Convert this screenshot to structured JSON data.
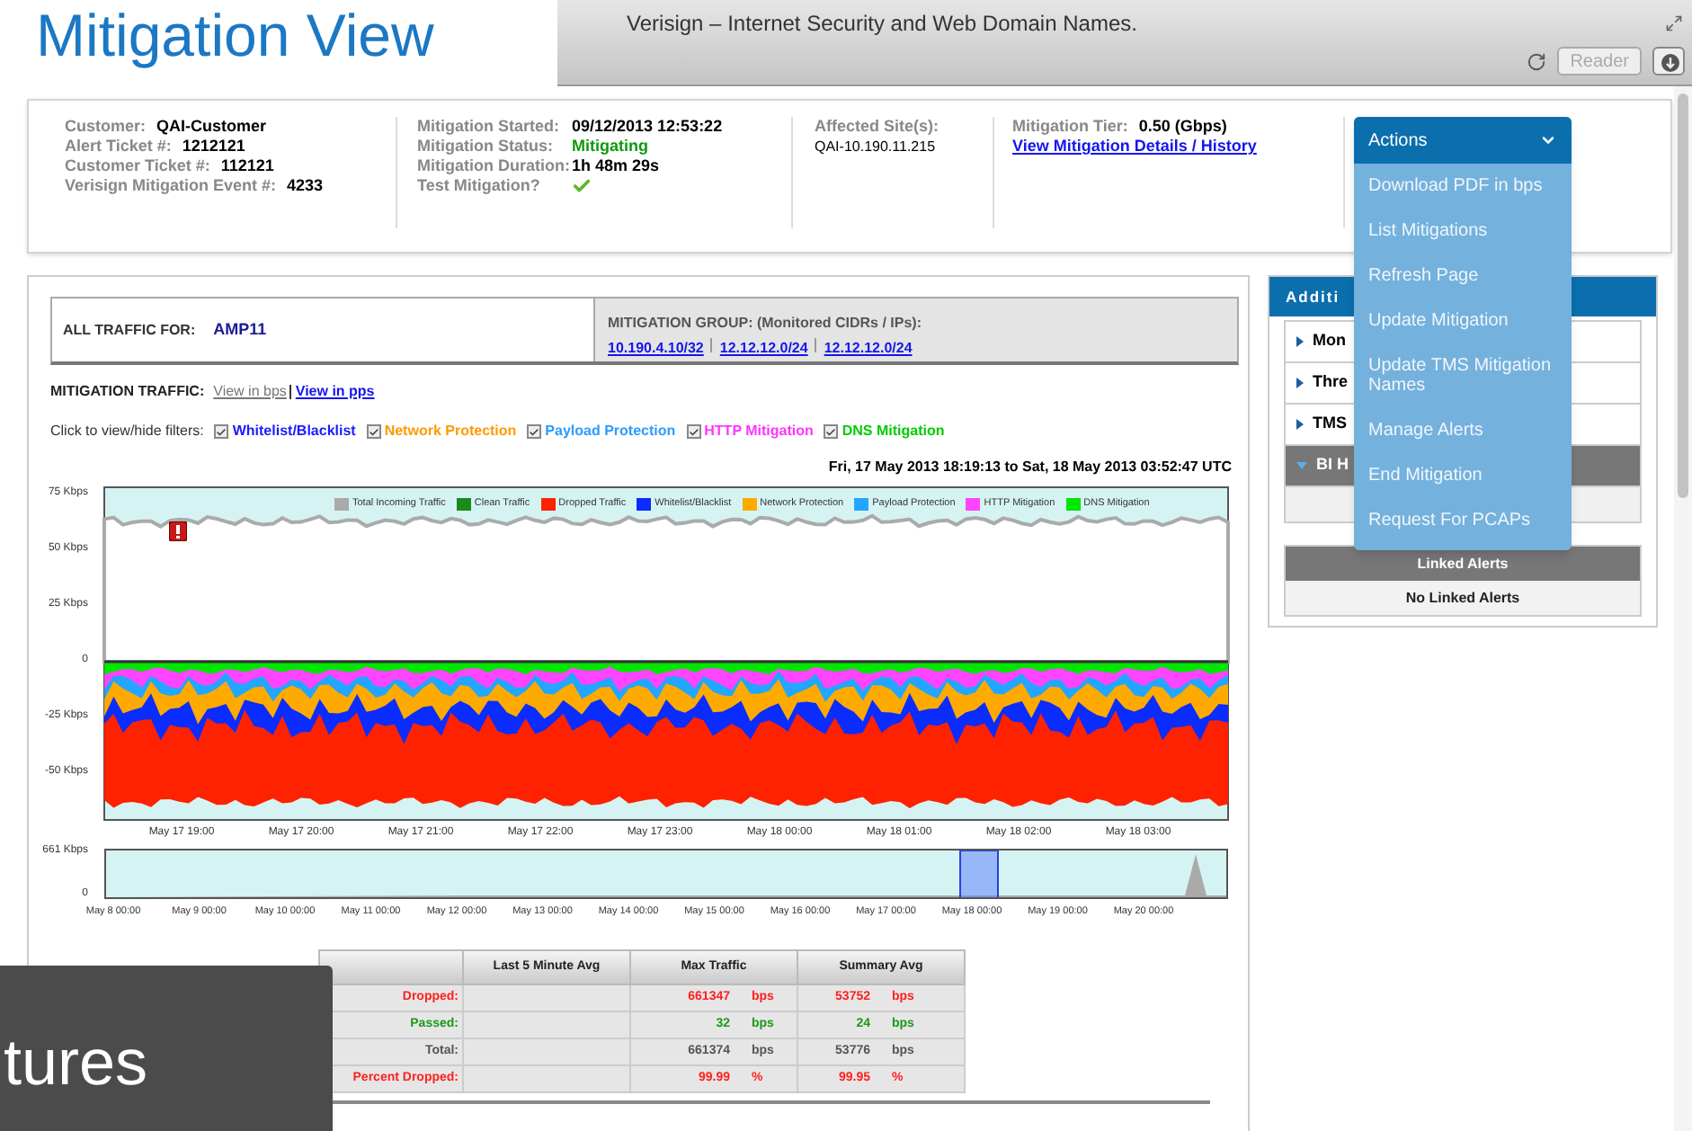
{
  "overlay_title": "Mitigation View",
  "browser": {
    "title": "Verisign – Internet Security and Web Domain Names.",
    "reader_button": "Reader"
  },
  "summary": {
    "customer": [
      {
        "label": "Customer:",
        "value": "QAI-Customer"
      },
      {
        "label": "Alert Ticket #:",
        "value": "1212121"
      },
      {
        "label": "Customer Ticket #:",
        "value": "112121"
      },
      {
        "label": "Verisign Mitigation Event #:",
        "value": "4233"
      }
    ],
    "mitigation": [
      {
        "label": "Mitigation Started:",
        "value": "09/12/2013 12:53:22",
        "kind": "text"
      },
      {
        "label": "Mitigation Status:",
        "value": "Mitigating",
        "kind": "status"
      },
      {
        "label": "Mitigation Duration:",
        "value": "1h 48m 29s",
        "kind": "text"
      },
      {
        "label": "Test Mitigation?",
        "kind": "check",
        "checked": true
      }
    ],
    "affected": {
      "label": "Affected Site(s):",
      "value": "QAI-10.190.11.215"
    },
    "tier": {
      "label": "Mitigation Tier:",
      "value": "0.50 (Gbps)",
      "link": "View Mitigation Details / History"
    }
  },
  "actions": {
    "label": "Actions",
    "items": [
      "Download PDF in bps",
      "List Mitigations",
      "Refresh Page",
      "Update Mitigation",
      "Update TMS Mitigation Names",
      "Manage Alerts",
      "End Mitigation",
      "Request For PCAPs"
    ]
  },
  "traffic": {
    "all_traffic_label": "ALL TRAFFIC FOR:",
    "all_traffic_value": "AMP11",
    "group_label": "MITIGATION GROUP: (Monitored CIDRs / IPs):",
    "group_links": [
      "10.190.4.10/32",
      "12.12.12.0/24",
      "12.12.12.0/24"
    ],
    "view_label": "MITIGATION TRAFFIC:",
    "views": [
      {
        "label": "View in bps",
        "selected": true
      },
      {
        "label": "View in pps",
        "selected": false
      }
    ],
    "filters_label": "Click to view/hide filters:",
    "filters": [
      {
        "label": "Whitelist/Blacklist",
        "checked": true,
        "color": "#1a1aff"
      },
      {
        "label": "Network Protection",
        "checked": true,
        "color": "#ff9900"
      },
      {
        "label": "Payload Protection",
        "checked": true,
        "color": "#2a9cff"
      },
      {
        "label": "HTTP Mitigation",
        "checked": true,
        "color": "#ff33ff"
      },
      {
        "label": "DNS Mitigation",
        "checked": true,
        "color": "#00cc00"
      }
    ],
    "range": "Fri, 17 May 2013 18:19:13 to Sat, 18 May 2013 03:52:47 UTC",
    "legend": [
      {
        "label": "Total Incoming Traffic",
        "color": "#aaaaaa"
      },
      {
        "label": "Clean Traffic",
        "color": "#1a8a1a"
      },
      {
        "label": "Dropped Traffic",
        "color": "#ff2200"
      },
      {
        "label": "Whitelist/Blacklist",
        "color": "#0a2cff"
      },
      {
        "label": "Network Protection",
        "color": "#ffaa00"
      },
      {
        "label": "Payload Protection",
        "color": "#22a6ff"
      },
      {
        "label": "HTTP Mitigation",
        "color": "#ff44ff"
      },
      {
        "label": "DNS Mitigation",
        "color": "#00e600"
      }
    ],
    "y_ticks": [
      "75 Kbps",
      "50 Kbps",
      "25 Kbps",
      "0",
      "-25 Kbps",
      "-50 Kbps"
    ],
    "x_ticks": [
      "May 17 19:00",
      "May 17 20:00",
      "May 17 21:00",
      "May 17 22:00",
      "May 17 23:00",
      "May 18 00:00",
      "May 18 01:00",
      "May 18 02:00",
      "May 18 03:00"
    ],
    "nav_y_ticks": [
      "661 Kbps",
      "0"
    ],
    "nav_x_ticks": [
      "May 8 00:00",
      "May 9 00:00",
      "May 10 00:00",
      "May 11 00:00",
      "May 12 00:00",
      "May 13 00:00",
      "May 14 00:00",
      "May 15 00:00",
      "May 16 00:00",
      "May 17 00:00",
      "May 18 00:00",
      "May 19 00:00",
      "May 20 00:00"
    ]
  },
  "stats": {
    "columns": [
      "Last 5 Minute Avg",
      "Max Traffic",
      "Summary Avg"
    ],
    "rows": [
      {
        "label": "Dropped:",
        "kind": "dropped",
        "max": "661347",
        "max_unit": "bps",
        "summary": "53752",
        "summary_unit": "bps"
      },
      {
        "label": "Passed:",
        "kind": "passed",
        "max": "32",
        "max_unit": "bps",
        "summary": "24",
        "summary_unit": "bps"
      },
      {
        "label": "Total:",
        "kind": "total",
        "max": "661374",
        "max_unit": "bps",
        "summary": "53776",
        "summary_unit": "bps"
      },
      {
        "label": "Percent Dropped:",
        "kind": "dropped",
        "max": "99.99",
        "max_unit": "%",
        "summary": "99.95",
        "summary_unit": "%"
      }
    ]
  },
  "additional": {
    "title": "Additi",
    "sections": [
      {
        "label": "Mon",
        "expanded": false
      },
      {
        "label": "Thre",
        "expanded": false
      },
      {
        "label": "TMS",
        "expanded": false
      },
      {
        "label": "BI H",
        "expanded": true
      }
    ],
    "linked_header": "Linked Alerts",
    "linked_empty": "No Linked Alerts"
  },
  "bottom_overlay": "tures"
}
